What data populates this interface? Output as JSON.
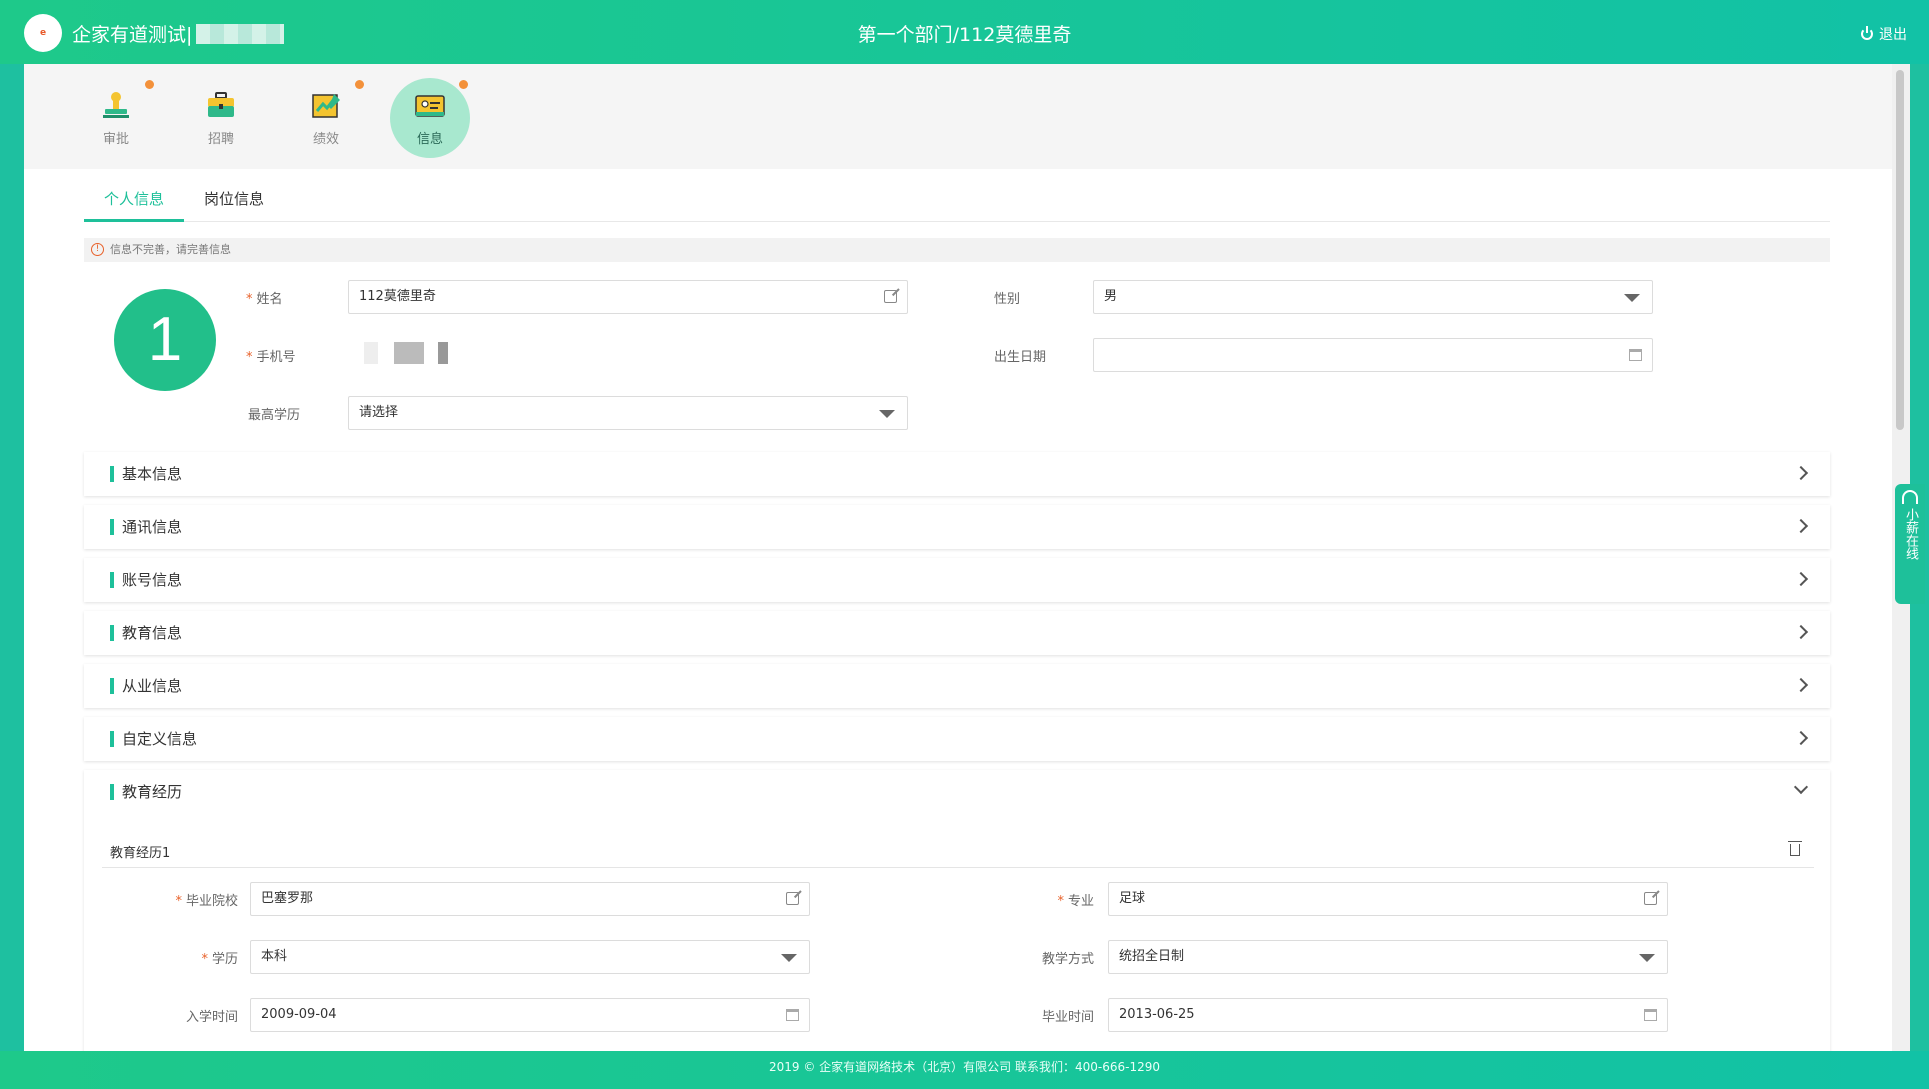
{
  "header": {
    "logo_text": "e",
    "company": "企家有道测试|",
    "title": "第一个部门/112莫德里奇",
    "logout": "退出"
  },
  "nav": {
    "items": [
      {
        "label": "审批",
        "icon": "stamp-icon",
        "badge": true
      },
      {
        "label": "招聘",
        "icon": "briefcase-icon",
        "badge": false
      },
      {
        "label": "绩效",
        "icon": "chart-icon",
        "badge": true
      },
      {
        "label": "信息",
        "icon": "id-card-icon",
        "badge": true,
        "active": true
      }
    ]
  },
  "tabs": [
    {
      "label": "个人信息",
      "active": true
    },
    {
      "label": "岗位信息",
      "active": false
    }
  ],
  "alert": "信息不完善，请完善信息",
  "profile": {
    "avatar": "1",
    "name_label": "姓名",
    "name_value": "112莫德里奇",
    "gender_label": "性别",
    "gender_value": "男",
    "phone_label": "手机号",
    "birth_label": "出生日期",
    "birth_value": "",
    "edu_label": "最高学历",
    "edu_value": "请选择"
  },
  "sections": [
    "基本信息",
    "通讯信息",
    "账号信息",
    "教育信息",
    "从业信息",
    "自定义信息",
    "教育经历"
  ],
  "education": {
    "subtitle": "教育经历1",
    "school_label": "毕业院校",
    "school_value": "巴塞罗那",
    "major_label": "专业",
    "major_value": "足球",
    "degree_label": "学历",
    "degree_value": "本科",
    "mode_label": "教学方式",
    "mode_value": "统招全日制",
    "start_label": "入学时间",
    "start_value": "2009-09-04",
    "end_label": "毕业时间",
    "end_value": "2013-06-25"
  },
  "chat": "小薪在线",
  "footer": "2019 © 企家有道网络技术（北京）有限公司    联系我们：400-666-1290",
  "colors": {
    "accent": "#1ec09a",
    "required": "#e8612a",
    "badge": "#f3913a"
  }
}
